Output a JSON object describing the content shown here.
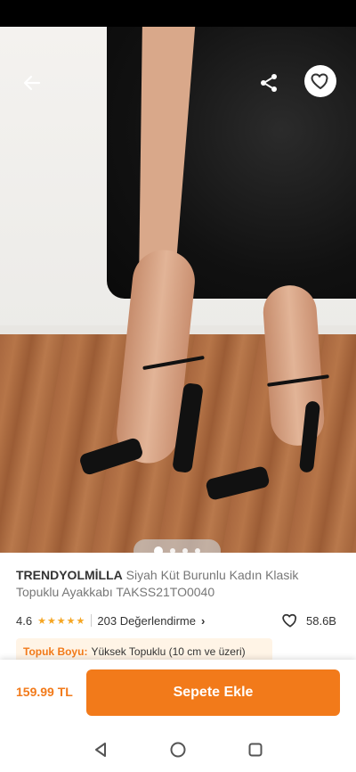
{
  "product": {
    "brand": "TRENDYOLMİLLA",
    "title": "Siyah Küt Burunlu Kadın Klasik Topuklu Ayakkabı TAKSS21TO0040",
    "rating": "4.6",
    "rating_stars": 4.6,
    "reviews_label": "203 Değerlendirme",
    "favorites": "58.6B"
  },
  "attribute": {
    "key": "Topuk Boyu:",
    "value": "Yüksek Topuklu (10 cm ve üzeri)"
  },
  "gallery": {
    "image_count": 4,
    "active_index": 0
  },
  "bottom": {
    "price": "159.99 TL",
    "cta_label": "Sepete Ekle"
  },
  "colors": {
    "accent": "#f27a1a",
    "star": "#f5a623"
  },
  "icons": {
    "back": "arrow-left-icon",
    "share": "share-icon",
    "favorite": "heart-icon",
    "nav_back": "triangle-back-icon",
    "nav_home": "circle-home-icon",
    "nav_recents": "square-recents-icon"
  }
}
